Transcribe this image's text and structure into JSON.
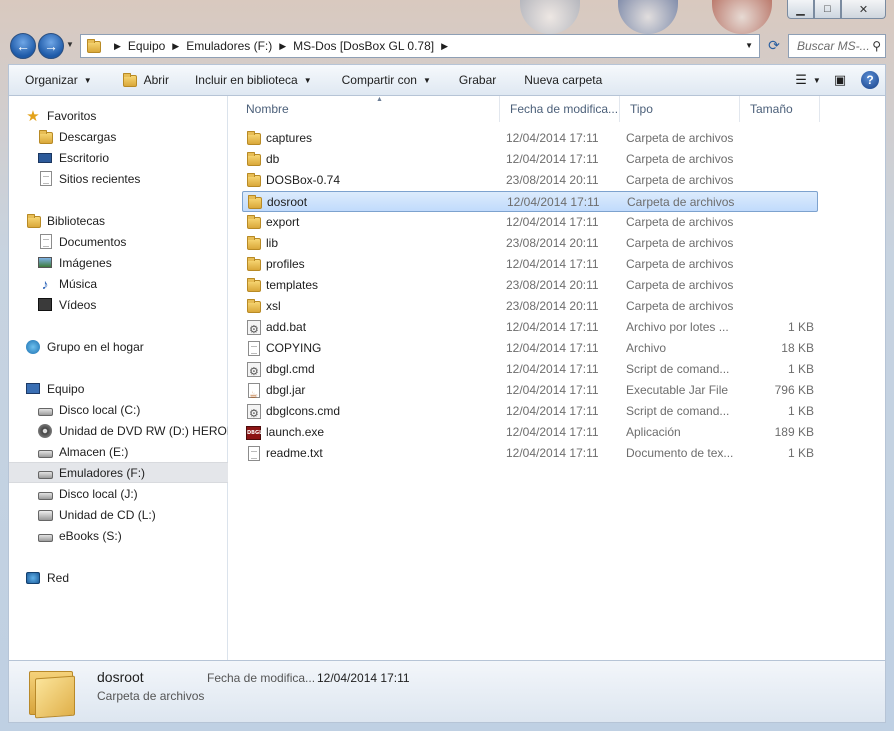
{
  "window": {
    "caption_buttons": {
      "minimize": "▁",
      "maximize": "□",
      "close": "✕"
    }
  },
  "navigation": {
    "back_icon": "arrow-left-icon",
    "forward_icon": "arrow-right-icon",
    "breadcrumbs": [
      "Equipo",
      "Emuladores (F:)",
      "MS-Dos [DosBox GL 0.78]"
    ],
    "search_placeholder": "Buscar MS-..."
  },
  "toolbar": {
    "organize": "Organizar",
    "open": "Abrir",
    "include_in_library": "Incluir en biblioteca",
    "share_with": "Compartir con",
    "burn": "Grabar",
    "new_folder": "Nueva carpeta"
  },
  "sidebar": {
    "favorites": {
      "label": "Favoritos",
      "items": [
        "Descargas",
        "Escritorio",
        "Sitios recientes"
      ]
    },
    "libraries": {
      "label": "Bibliotecas",
      "items": [
        "Documentos",
        "Imágenes",
        "Música",
        "Vídeos"
      ]
    },
    "homegroup": {
      "label": "Grupo en el hogar"
    },
    "computer": {
      "label": "Equipo",
      "items": [
        "Disco local (C:)",
        "Unidad de DVD RW (D:) HEROES",
        "Almacen (E:)",
        "Emuladores (F:)",
        "Disco local (J:)",
        "Unidad de CD (L:)",
        "eBooks (S:)"
      ],
      "selected": "Emuladores (F:)"
    },
    "network": {
      "label": "Red"
    }
  },
  "file_list": {
    "columns": [
      "Nombre",
      "Fecha de modifica...",
      "Tipo",
      "Tamaño"
    ],
    "selected": "dosroot",
    "rows": [
      {
        "name": "captures",
        "date": "12/04/2014 17:11",
        "type": "Carpeta de archivos",
        "size": "",
        "icon": "folder"
      },
      {
        "name": "db",
        "date": "12/04/2014 17:11",
        "type": "Carpeta de archivos",
        "size": "",
        "icon": "folder"
      },
      {
        "name": "DOSBox-0.74",
        "date": "23/08/2014 20:11",
        "type": "Carpeta de archivos",
        "size": "",
        "icon": "folder"
      },
      {
        "name": "dosroot",
        "date": "12/04/2014 17:11",
        "type": "Carpeta de archivos",
        "size": "",
        "icon": "folder"
      },
      {
        "name": "export",
        "date": "12/04/2014 17:11",
        "type": "Carpeta de archivos",
        "size": "",
        "icon": "folder"
      },
      {
        "name": "lib",
        "date": "23/08/2014 20:11",
        "type": "Carpeta de archivos",
        "size": "",
        "icon": "folder"
      },
      {
        "name": "profiles",
        "date": "12/04/2014 17:11",
        "type": "Carpeta de archivos",
        "size": "",
        "icon": "folder"
      },
      {
        "name": "templates",
        "date": "23/08/2014 20:11",
        "type": "Carpeta de archivos",
        "size": "",
        "icon": "folder"
      },
      {
        "name": "xsl",
        "date": "23/08/2014 20:11",
        "type": "Carpeta de archivos",
        "size": "",
        "icon": "folder"
      },
      {
        "name": "add.bat",
        "date": "12/04/2014 17:11",
        "type": "Archivo por lotes ...",
        "size": "1 KB",
        "icon": "gear"
      },
      {
        "name": "COPYING",
        "date": "12/04/2014 17:11",
        "type": "Archivo",
        "size": "18 KB",
        "icon": "file"
      },
      {
        "name": "dbgl.cmd",
        "date": "12/04/2014 17:11",
        "type": "Script de comand...",
        "size": "1 KB",
        "icon": "gear"
      },
      {
        "name": "dbgl.jar",
        "date": "12/04/2014 17:11",
        "type": "Executable Jar File",
        "size": "796 KB",
        "icon": "jar"
      },
      {
        "name": "dbglcons.cmd",
        "date": "12/04/2014 17:11",
        "type": "Script de comand...",
        "size": "1 KB",
        "icon": "gear"
      },
      {
        "name": "launch.exe",
        "date": "12/04/2014 17:11",
        "type": "Aplicación",
        "size": "189 KB",
        "icon": "exe"
      },
      {
        "name": "readme.txt",
        "date": "12/04/2014 17:11",
        "type": "Documento de tex...",
        "size": "1 KB",
        "icon": "file"
      }
    ],
    "exe_icon_text": "DBGL"
  },
  "details": {
    "name": "dosroot",
    "type": "Carpeta de archivos",
    "date_label": "Fecha de modifica...",
    "date_value": "12/04/2014 17:11"
  }
}
